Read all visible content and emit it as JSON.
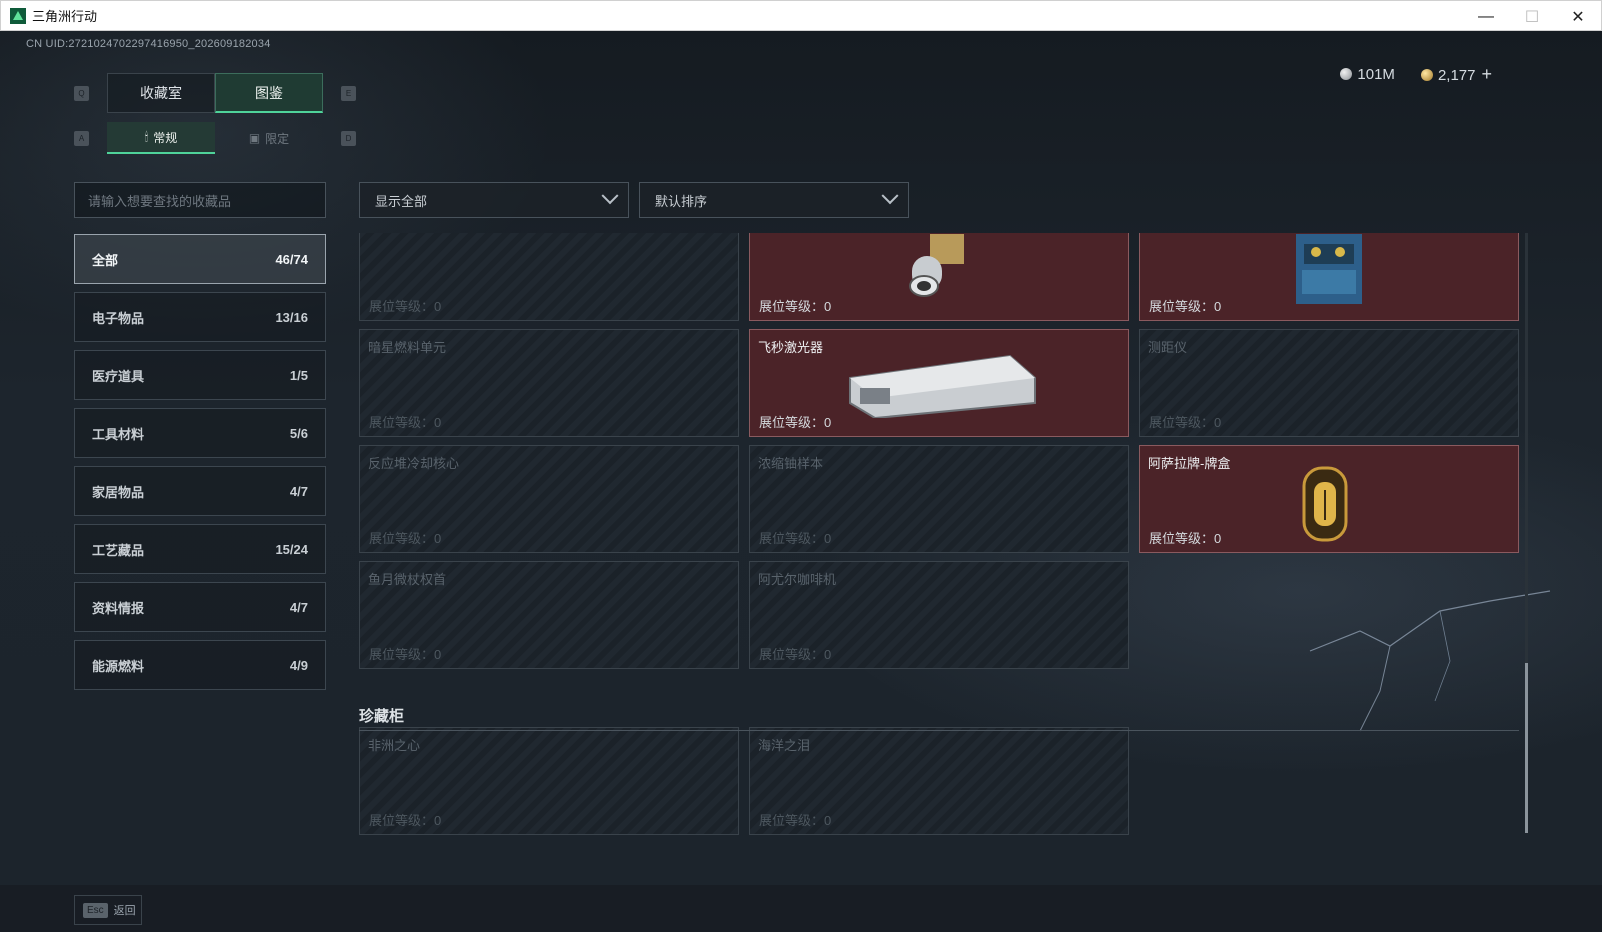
{
  "window": {
    "title": "三角洲行动",
    "controls": [
      "—",
      "☐",
      "✕"
    ]
  },
  "uid": "CN UID:2721024702297416950_202609182034",
  "currency": [
    {
      "icon": "silver-coin-icon",
      "value": "101M"
    },
    {
      "icon": "gold-coin-icon",
      "value": "2,177",
      "plus": "+"
    }
  ],
  "main_tabs": {
    "left_key": "Q",
    "right_key": "E",
    "items": [
      {
        "label": "收藏室",
        "active": false
      },
      {
        "label": "图鉴",
        "active": true
      }
    ]
  },
  "sub_tabs": {
    "left_key": "A",
    "right_key": "D",
    "items": [
      {
        "label": "常规",
        "icon": "trophy-icon",
        "active": true
      },
      {
        "label": "限定",
        "icon": "picture-icon",
        "active": false
      }
    ]
  },
  "search": {
    "placeholder": "请输入想要查找的收藏品"
  },
  "categories": [
    {
      "label": "全部",
      "count": "46/74",
      "active": true
    },
    {
      "label": "电子物品",
      "count": "13/16"
    },
    {
      "label": "医疗道具",
      "count": "1/5"
    },
    {
      "label": "工具材料",
      "count": "5/6"
    },
    {
      "label": "家居物品",
      "count": "4/7"
    },
    {
      "label": "工艺藏品",
      "count": "15/24"
    },
    {
      "label": "资料情报",
      "count": "4/7"
    },
    {
      "label": "能源燃料",
      "count": "4/9"
    }
  ],
  "filters": {
    "show": "显示全部",
    "sort": "默认排序"
  },
  "cards": [
    {
      "name": "",
      "level": "展位等级：0",
      "owned": false
    },
    {
      "name": "",
      "level": "展位等级：0",
      "owned": true
    },
    {
      "name": "",
      "level": "展位等级：0",
      "owned": true
    },
    {
      "name": "暗星燃料单元",
      "level": "展位等级：0",
      "owned": false
    },
    {
      "name": "飞秒激光器",
      "level": "展位等级：0",
      "owned": true
    },
    {
      "name": "测距仪",
      "level": "展位等级：0",
      "owned": false
    },
    {
      "name": "反应堆冷却核心",
      "level": "展位等级：0",
      "owned": false
    },
    {
      "name": "浓缩铀样本",
      "level": "展位等级：0",
      "owned": false
    },
    {
      "name": "阿萨拉牌-牌盒",
      "level": "展位等级：0",
      "owned": true
    },
    {
      "name": "鱼月微杖权首",
      "level": "展位等级：0",
      "owned": false
    },
    {
      "name": "阿尤尔咖啡机",
      "level": "展位等级：0",
      "owned": false
    }
  ],
  "section": {
    "title": "珍藏柜"
  },
  "cabinet_cards": [
    {
      "name": "非洲之心",
      "level": "展位等级：0",
      "owned": false
    },
    {
      "name": "海洋之泪",
      "level": "展位等级：0",
      "owned": false
    }
  ],
  "footer": {
    "key": "Esc",
    "label": "返回"
  },
  "colors": {
    "accent": "#4fd39a",
    "owned_card": "#4b2328",
    "background": "#1a2128"
  }
}
